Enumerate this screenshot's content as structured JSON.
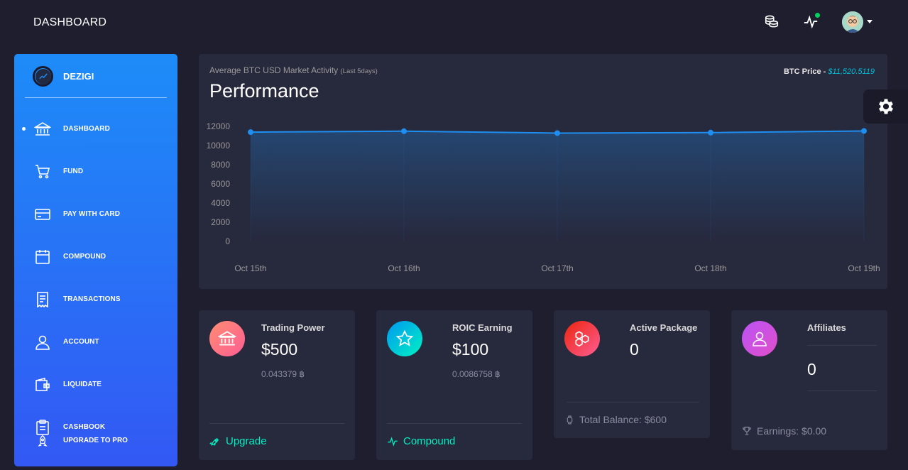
{
  "header": {
    "brand": "DASHBOARD",
    "icons": [
      "database-icon",
      "activity-icon",
      "avatar"
    ],
    "notification_dot_color": "#00d25b"
  },
  "sidebar": {
    "logo_text": "DEZIGI",
    "active_index": 0,
    "items": [
      {
        "label": "DASHBOARD",
        "icon": "bank-icon"
      },
      {
        "label": "FUND",
        "icon": "cart-icon"
      },
      {
        "label": "PAY WITH CARD",
        "icon": "credit-card-icon"
      },
      {
        "label": "COMPOUND",
        "icon": "calendar-icon"
      },
      {
        "label": "TRANSACTIONS",
        "icon": "receipt-icon"
      },
      {
        "label": "ACCOUNT",
        "icon": "user-icon"
      },
      {
        "label": "LIQUIDATE",
        "icon": "wallet-icon"
      },
      {
        "label": "CASHBOOK",
        "icon": "clipboard-icon"
      }
    ],
    "upgrade_label": "UPGRADE TO PRO",
    "gradient": [
      "#1d8cf8",
      "#3358f4"
    ]
  },
  "chart_card": {
    "subtitle": "Average BTC USD Market Activity",
    "subtitle_note": "(Last 5days)",
    "title": "Performance",
    "price_label": "BTC Price -",
    "price_value": "$11,520.5119"
  },
  "chart_data": {
    "type": "area",
    "categories": [
      "Oct 15th",
      "Oct 16th",
      "Oct 17th",
      "Oct 18th",
      "Oct 19th"
    ],
    "values": [
      11400,
      11500,
      11300,
      11350,
      11520
    ],
    "yticks": [
      0,
      2000,
      4000,
      6000,
      8000,
      10000,
      12000
    ],
    "ylim": [
      0,
      12000
    ],
    "color": "#1f8ef1",
    "grid": "vertical"
  },
  "stats": [
    {
      "label": "Trading Power",
      "value": "$500",
      "sub": "0.043379 ฿",
      "footer": "Upgrade",
      "footer_icon": "rocket-icon",
      "icon": "bank-icon",
      "icon_color": "#fd5d93",
      "footer_color": "#00f2c3"
    },
    {
      "label": "ROIC Earning",
      "value": "$100",
      "sub": "0.0086758 ฿",
      "footer": "Compound",
      "footer_icon": "activity-icon",
      "icon": "star-icon",
      "icon_color": "#00bfd8",
      "footer_color": "#00f2c3"
    },
    {
      "label": "Active Package",
      "value": "0",
      "footer": "Total Balance: $600",
      "footer_icon": "watch-icon",
      "icon": "hexagons-icon",
      "icon_color": "#f5365c",
      "footer_color": "#8b8ba0"
    },
    {
      "label": "Affiliates",
      "value": "0",
      "footer": "Earnings: $0.00",
      "footer_icon": "trophy-icon",
      "icon": "user-icon",
      "icon_color": "#ba54f5",
      "footer_color": "#8b8ba0"
    }
  ]
}
